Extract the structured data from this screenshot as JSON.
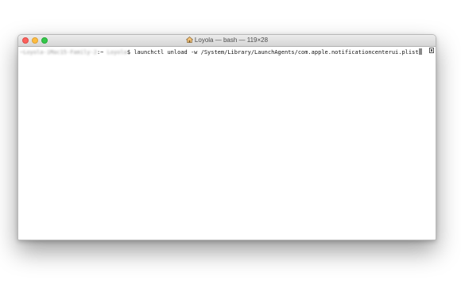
{
  "window": {
    "title": "Loyola — bash — 119×28",
    "title_icon": "home-icon"
  },
  "terminal": {
    "prompt_host": "~Loyola-iMac15-Family-2",
    "prompt_path": ":~ ",
    "prompt_user": "Loyola",
    "prompt_symbol": "$",
    "command": " launchctl unload -w /System/Library/LaunchAgents/com.apple.notificationcenterui.plist"
  },
  "colors": {
    "close": "#fc605c",
    "minimize": "#fdbc40",
    "maximize": "#34c84a"
  }
}
